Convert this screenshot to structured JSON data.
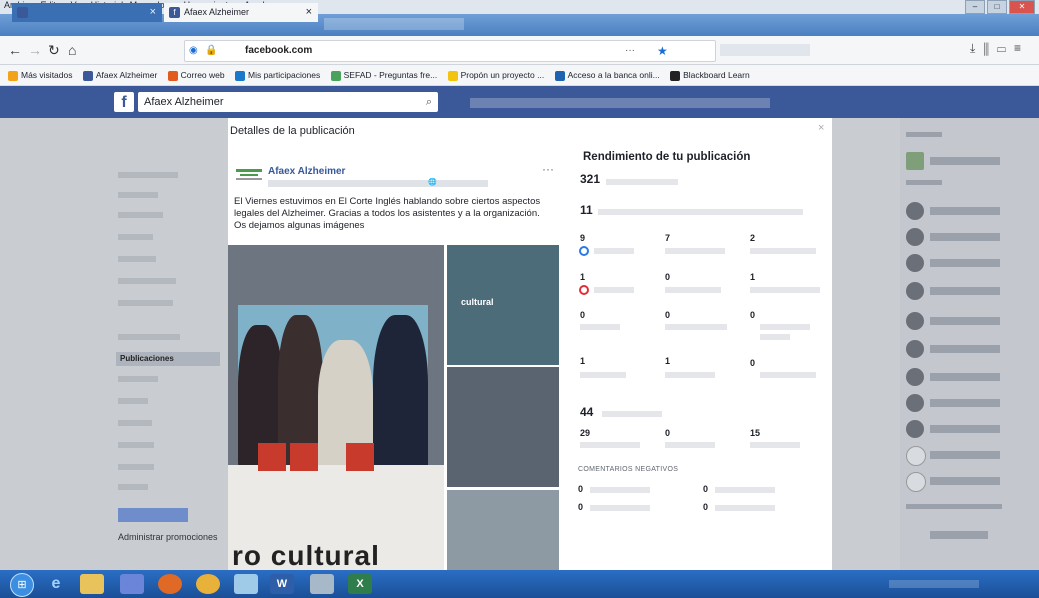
{
  "menubar": [
    "Archivo",
    "Editar",
    "Ver",
    "Historial",
    "Marcadores",
    "Herramientas",
    "Ayuda"
  ],
  "tabs": {
    "active_label": "Afaex Alzheimer",
    "active_icon": "f"
  },
  "browser": {
    "url_domain": "facebook.com",
    "url_more": "···"
  },
  "bookmarks": [
    {
      "label": "Más visitados",
      "color": "#f3a317"
    },
    {
      "label": "Afaex Alzheimer",
      "color": "#3b5998"
    },
    {
      "label": "Correo web",
      "color": "#e25a1c"
    },
    {
      "label": "Mis participaciones",
      "color": "#1b77c9"
    },
    {
      "label": "SEFAD - Preguntas fre...",
      "color": "#4aa35c"
    },
    {
      "label": "Propón un proyecto ...",
      "color": "#f2c40f"
    },
    {
      "label": "Acceso a la banca onli...",
      "color": "#1f62b0"
    },
    {
      "label": "Blackboard Learn",
      "color": "#222222"
    }
  ],
  "fb": {
    "logo": "f",
    "search_value": "Afaex Alzheimer"
  },
  "left_nav": {
    "active": "Publicaciones",
    "admin_promotions": "Administrar promociones"
  },
  "modal": {
    "title": "Detalles de la publicación",
    "close": "×",
    "page_name": "Afaex Alzheimer",
    "post_menu": "···",
    "post_text": "El Viernes estuvimos en El Corte Inglés hablando sobre ciertos aspectos legales del Alzheimer. Gracias a todos los asistentes y a la organización. Os dejamos algunas imágenes",
    "photo_sign": "cultural",
    "photo_caption": "ro cultural"
  },
  "performance": {
    "title": "Rendimiento de tu publicación",
    "reach": "321",
    "reactions_total": "11",
    "grid": [
      [
        "9",
        "7",
        "2"
      ],
      [
        "1",
        "0",
        "1"
      ],
      [
        "0",
        "0",
        "0"
      ],
      [
        "1",
        "1",
        "0"
      ]
    ],
    "clicks_total": "44",
    "clicks": [
      "29",
      "0",
      "15"
    ],
    "negative_label": "COMENTARIOS NEGATIVOS",
    "negative": [
      [
        "0",
        "0"
      ],
      [
        "0",
        "0"
      ]
    ]
  },
  "colors": {
    "fb_blue": "#3b5998",
    "like_blue": "#2b7be4",
    "love_red": "#e02f3b"
  },
  "icons": [
    "back-icon",
    "forward-icon",
    "reload-icon",
    "home-icon",
    "bookmark-star-icon",
    "search-icon",
    "download-icon",
    "library-icon",
    "sidebar-icon",
    "menu-icon"
  ]
}
